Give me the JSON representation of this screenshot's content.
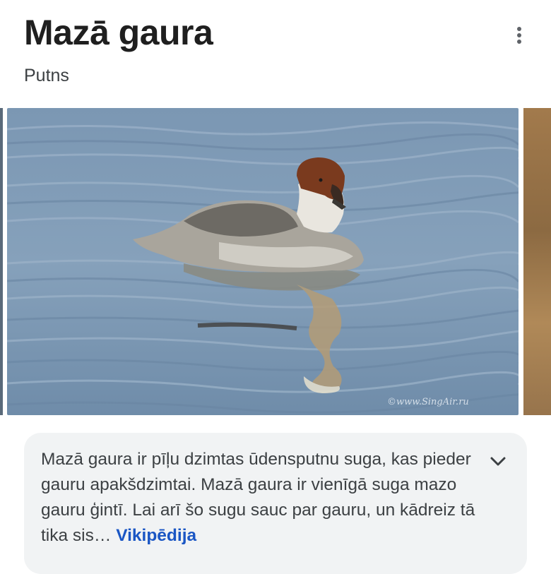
{
  "header": {
    "title": "Mazā gaura",
    "subtitle": "Putns",
    "menu_icon": "more-vert-icon"
  },
  "images": {
    "main_alt": "Mazā gaura",
    "watermark": "©www.SingAir.ru"
  },
  "description": {
    "text": "Mazā gaura ir pīļu dzimtas ūdensputnu suga, kas pieder gauru apakšdzimtai. Mazā gaura ir vienīgā suga mazo gauru ģintī. Lai arī šo sugu sauc par gauru, un kādreiz tā tika sis",
    "ellipsis": "…",
    "source": "Vikipēdija",
    "expand_icon": "chevron-down-icon"
  },
  "colors": {
    "title": "#1f1f1f",
    "link": "#1a56c4",
    "card_bg": "#f1f3f4",
    "water": "#7f9bb6"
  }
}
